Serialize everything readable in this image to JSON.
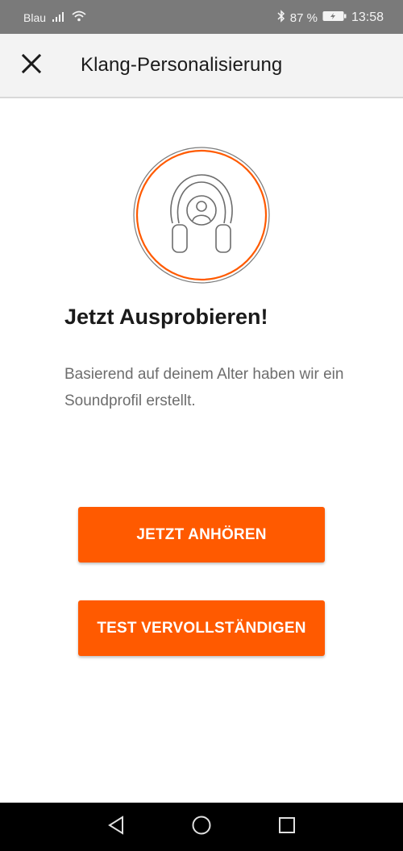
{
  "status_bar": {
    "carrier": "Blau",
    "battery_percent": "87 %",
    "time": "13:58",
    "icons": [
      "signal-icon",
      "wifi-icon",
      "bluetooth-icon",
      "battery-icon"
    ]
  },
  "app_bar": {
    "title": "Klang-Personalisierung",
    "close_icon": "close-icon"
  },
  "content": {
    "illustration": "headphones-profile-icon",
    "heading": "Jetzt Ausprobieren!",
    "description": "Basierend auf deinem Alter haben wir ein Soundprofil erstellt."
  },
  "buttons": {
    "listen_label": "JETZT ANHÖREN",
    "complete_label": "TEST VERVOLLSTÄNDIGEN"
  },
  "colors": {
    "accent": "#ff5a00",
    "statusbar": "#7a7a7a",
    "appbar": "#f3f3f3"
  },
  "nav_bar": {
    "icons": [
      "back-icon",
      "home-icon",
      "recents-icon"
    ]
  }
}
